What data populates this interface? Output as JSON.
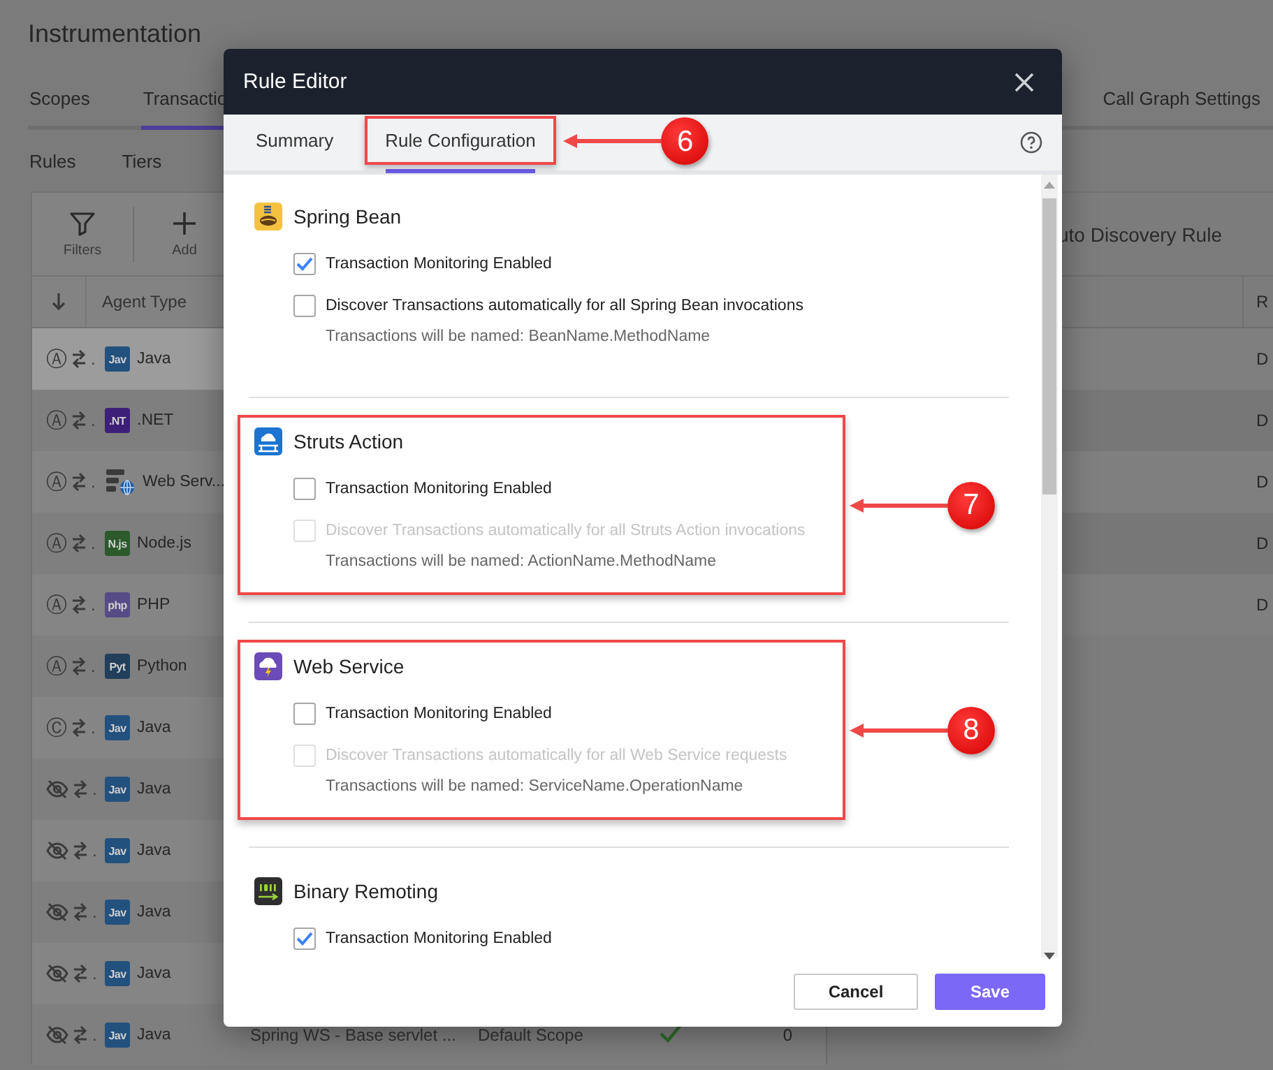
{
  "page": {
    "title": "Instrumentation",
    "tabs": [
      {
        "label": "Scopes",
        "selected": false
      },
      {
        "label": "Transactio",
        "selected": true
      },
      {
        "label": "Call Graph Settings",
        "selected": false
      }
    ],
    "subtabs": [
      "Rules",
      "Tiers"
    ],
    "toolbar": [
      {
        "kind": "filter",
        "label": "Filters"
      },
      {
        "kind": "add",
        "label": "Add"
      }
    ],
    "table": {
      "columns": [
        "Agent Type"
      ],
      "rows": [
        {
          "selected": true,
          "mode": {
            "kind": "letter",
            "symbol": "Ⓐ"
          },
          "column_1": ".",
          "agent": {
            "kind": "badge",
            "badge": "Jav",
            "color": "#23517e"
          },
          "agent_type": "Java"
        },
        {
          "selected": false,
          "mode": {
            "kind": "letter",
            "symbol": "Ⓐ"
          },
          "column_1": ".",
          "agent": {
            "kind": "badge",
            "badge": ".NT",
            "color": "#3d1f78"
          },
          "agent_type": ".NET"
        },
        {
          "selected": false,
          "mode": {
            "kind": "letter",
            "symbol": "Ⓐ"
          },
          "column_1": ".",
          "agent": {
            "kind": "server"
          },
          "agent_type": "Web Serv..."
        },
        {
          "selected": false,
          "mode": {
            "kind": "letter",
            "symbol": "Ⓐ"
          },
          "column_1": ".",
          "agent": {
            "kind": "badge",
            "badge": "N.js",
            "color": "#2c5a2c"
          },
          "agent_type": "Node.js"
        },
        {
          "selected": false,
          "mode": {
            "kind": "letter",
            "symbol": "Ⓐ"
          },
          "column_1": ".",
          "agent": {
            "kind": "badge",
            "badge": "php",
            "color": "#574b86"
          },
          "agent_type": "PHP"
        },
        {
          "selected": false,
          "mode": {
            "kind": "letter",
            "symbol": "Ⓐ"
          },
          "column_1": ".",
          "agent": {
            "kind": "badge",
            "badge": "Pyt",
            "color": "#213e5a"
          },
          "agent_type": "Python"
        },
        {
          "selected": false,
          "mode": {
            "kind": "letter",
            "symbol": "Ⓒ"
          },
          "column_1": ".",
          "agent": {
            "kind": "badge",
            "badge": "Jav",
            "color": "#23517e"
          },
          "agent_type": "Java"
        },
        {
          "selected": false,
          "mode": {
            "kind": "hidden"
          },
          "column_1": ".",
          "agent": {
            "kind": "badge",
            "badge": "Jav",
            "color": "#23517e"
          },
          "agent_type": "Java"
        },
        {
          "selected": false,
          "mode": {
            "kind": "hidden"
          },
          "column_1": ".",
          "agent": {
            "kind": "badge",
            "badge": "Jav",
            "color": "#23517e"
          },
          "agent_type": "Java"
        },
        {
          "selected": false,
          "mode": {
            "kind": "hidden"
          },
          "column_1": ".",
          "agent": {
            "kind": "badge",
            "badge": "Jav",
            "color": "#23517e"
          },
          "agent_type": "Java"
        },
        {
          "selected": false,
          "mode": {
            "kind": "hidden"
          },
          "column_1": ".",
          "agent": {
            "kind": "badge",
            "badge": "Jav",
            "color": "#23517e"
          },
          "agent_type": "Java"
        },
        {
          "selected": false,
          "mode": {
            "kind": "hidden"
          },
          "column_1": ".",
          "agent": {
            "kind": "badge",
            "badge": "Jav",
            "color": "#23517e"
          },
          "agent_type": "Java",
          "name": "Spring WS - Base servlet ...",
          "scope": "Default Scope",
          "enabled": true,
          "count": "0"
        }
      ]
    },
    "right_panel": {
      "title": "uto Discovery Rule",
      "columns": [
        "R"
      ],
      "rows": [
        "D",
        "D",
        "D",
        "D",
        "D"
      ]
    }
  },
  "dialog": {
    "title": "Rule Editor",
    "tabs": [
      {
        "label": "Summary",
        "selected": false
      },
      {
        "label": "Rule Configuration",
        "selected": true,
        "callout": "6"
      }
    ],
    "sections": [
      {
        "kind": "spring",
        "title": "Spring Bean",
        "options": [
          {
            "label": "Transaction Monitoring Enabled",
            "checked": true,
            "disabled": false
          },
          {
            "label": "Discover Transactions automatically for all Spring Bean invocations",
            "checked": false,
            "disabled": false
          }
        ],
        "hint": "Transactions will be named: BeanName.MethodName"
      },
      {
        "kind": "struts",
        "title": "Struts Action",
        "callout": "7",
        "options": [
          {
            "label": "Transaction Monitoring Enabled",
            "checked": false,
            "disabled": false
          },
          {
            "label": "Discover Transactions automatically for all Struts Action invocations",
            "checked": false,
            "disabled": true
          }
        ],
        "hint": "Transactions will be named: ActionName.MethodName"
      },
      {
        "kind": "webservice",
        "title": "Web Service",
        "callout": "8",
        "options": [
          {
            "label": "Transaction Monitoring Enabled",
            "checked": false,
            "disabled": false
          },
          {
            "label": "Discover Transactions automatically for all Web Service requests",
            "checked": false,
            "disabled": true
          }
        ],
        "hint": "Transactions will be named: ServiceName.OperationName"
      },
      {
        "kind": "binary",
        "title": "Binary Remoting",
        "options": [
          {
            "label": "Transaction Monitoring Enabled",
            "checked": true,
            "disabled": false
          }
        ]
      }
    ],
    "buttons": [
      {
        "kind": "secondary",
        "label": "Cancel"
      },
      {
        "kind": "primary",
        "label": "Save"
      }
    ]
  }
}
